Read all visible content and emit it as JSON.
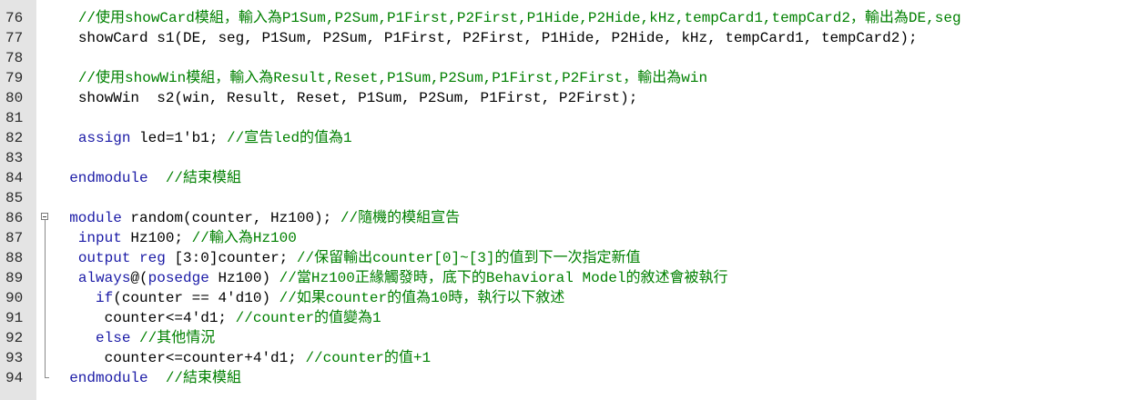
{
  "editor": {
    "lines": [
      {
        "no": "76",
        "indent": "   ",
        "parts": [
          {
            "t": "cm",
            "v": "//使用showCard模組，輸入為P1Sum,P2Sum,P1First,P2First,P1Hide,P2Hide,kHz,tempCard1,tempCard2，輸出為DE,seg"
          }
        ]
      },
      {
        "no": "77",
        "indent": "   ",
        "parts": [
          {
            "t": "tx",
            "v": "showCard s1(DE, seg, P1Sum, P2Sum, P1First, P2First, P1Hide, P2Hide, kHz, tempCard1, tempCard2);"
          }
        ]
      },
      {
        "no": "78",
        "indent": "",
        "parts": []
      },
      {
        "no": "79",
        "indent": "   ",
        "parts": [
          {
            "t": "cm",
            "v": "//使用showWin模組，輸入為Result,Reset,P1Sum,P2Sum,P1First,P2First，輸出為win"
          }
        ]
      },
      {
        "no": "80",
        "indent": "   ",
        "parts": [
          {
            "t": "tx",
            "v": "showWin  s2(win, Result, Reset, P1Sum, P2Sum, P1First, P2First);"
          }
        ]
      },
      {
        "no": "81",
        "indent": "",
        "parts": []
      },
      {
        "no": "82",
        "indent": "   ",
        "parts": [
          {
            "t": "kw",
            "v": "assign"
          },
          {
            "t": "tx",
            "v": " led=1'b1; "
          },
          {
            "t": "cm",
            "v": "//宣告led的值為1"
          }
        ]
      },
      {
        "no": "83",
        "indent": "",
        "parts": []
      },
      {
        "no": "84",
        "indent": "  ",
        "parts": [
          {
            "t": "kw",
            "v": "endmodule"
          },
          {
            "t": "tx",
            "v": "  "
          },
          {
            "t": "cm",
            "v": "//結束模組"
          }
        ]
      },
      {
        "no": "85",
        "indent": "",
        "parts": []
      },
      {
        "no": "86",
        "indent": "  ",
        "parts": [
          {
            "t": "kw",
            "v": "module"
          },
          {
            "t": "tx",
            "v": " random(counter, Hz100); "
          },
          {
            "t": "cm",
            "v": "//隨機的模組宣告"
          }
        ]
      },
      {
        "no": "87",
        "indent": "   ",
        "parts": [
          {
            "t": "kw",
            "v": "input"
          },
          {
            "t": "tx",
            "v": " Hz100; "
          },
          {
            "t": "cm",
            "v": "//輸入為Hz100"
          }
        ]
      },
      {
        "no": "88",
        "indent": "   ",
        "parts": [
          {
            "t": "kw",
            "v": "output"
          },
          {
            "t": "tx",
            "v": " "
          },
          {
            "t": "kw",
            "v": "reg"
          },
          {
            "t": "tx",
            "v": " [3:0]counter; "
          },
          {
            "t": "cm",
            "v": "//保留輸出counter[0]~[3]的值到下一次指定新值"
          }
        ]
      },
      {
        "no": "89",
        "indent": "   ",
        "parts": [
          {
            "t": "kw",
            "v": "always"
          },
          {
            "t": "tx",
            "v": "@("
          },
          {
            "t": "kw",
            "v": "posedge"
          },
          {
            "t": "tx",
            "v": " Hz100) "
          },
          {
            "t": "cm",
            "v": "//當Hz100正緣觸發時，底下的Behavioral Model的敘述會被執行"
          }
        ]
      },
      {
        "no": "90",
        "indent": "     ",
        "parts": [
          {
            "t": "kw",
            "v": "if"
          },
          {
            "t": "tx",
            "v": "(counter == 4'd10) "
          },
          {
            "t": "cm",
            "v": "//如果counter的值為10時，執行以下敘述"
          }
        ]
      },
      {
        "no": "91",
        "indent": "      ",
        "parts": [
          {
            "t": "tx",
            "v": "counter<=4'd1; "
          },
          {
            "t": "cm",
            "v": "//counter的值變為1"
          }
        ]
      },
      {
        "no": "92",
        "indent": "     ",
        "parts": [
          {
            "t": "kw",
            "v": "else"
          },
          {
            "t": "tx",
            "v": " "
          },
          {
            "t": "cm",
            "v": "//其他情況"
          }
        ]
      },
      {
        "no": "93",
        "indent": "      ",
        "parts": [
          {
            "t": "tx",
            "v": "counter<=counter+4'd1; "
          },
          {
            "t": "cm",
            "v": "//counter的值+1"
          }
        ]
      },
      {
        "no": "94",
        "indent": "  ",
        "parts": [
          {
            "t": "kw",
            "v": "endmodule"
          },
          {
            "t": "tx",
            "v": "  "
          },
          {
            "t": "cm",
            "v": "//結束模組"
          }
        ]
      }
    ]
  },
  "colors": {
    "keyword": "#1a1aa6",
    "comment": "#008000",
    "text": "#000000",
    "gutter": "#e4e4e4"
  },
  "icons": {
    "fold": "fold-collapse-icon"
  }
}
